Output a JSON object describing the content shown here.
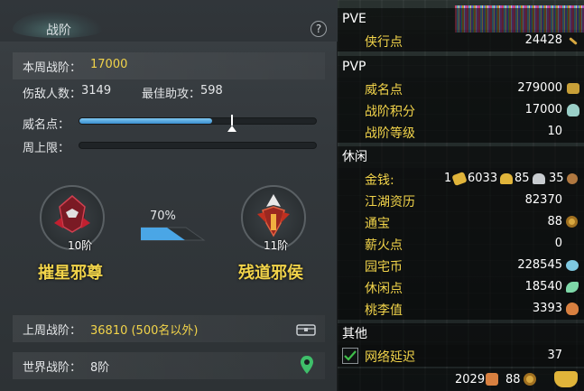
{
  "left": {
    "title": "战阶",
    "help_label": "?",
    "weekly_label": "本周战阶：",
    "weekly_value": "17000",
    "kills_label": "伤敌人数：",
    "kills_value": "3149",
    "assist_label": "最佳助攻：",
    "assist_value": "598",
    "prestige_label": "威名点：",
    "prestige_progress": 0.56,
    "weekly_cap_label": "周上限：",
    "weekly_cap_progress": 0.0,
    "current_rank": {
      "name": "摧星邪尊",
      "level": "10阶"
    },
    "next_rank": {
      "name": "残道邪侯",
      "level": "11阶"
    },
    "rank_progress_text": "70%",
    "rank_progress": 0.7,
    "last_week_label": "上周战阶：",
    "last_week_value": "36810 (500名以外)",
    "world_label": "世界战阶：",
    "world_value": "8阶"
  },
  "right": {
    "pve_title": "PVE",
    "pve_items": [
      {
        "label": "侠行点",
        "value": "24428"
      }
    ],
    "pvp_title": "PVP",
    "pvp_items": [
      {
        "label": "威名点",
        "value": "279000"
      },
      {
        "label": "战阶积分",
        "value": "17000"
      },
      {
        "label": "战阶等级",
        "value": "10"
      }
    ],
    "leisure_title": "休闲",
    "money_label": "金钱:",
    "money_gold": "1",
    "money_a": "6033",
    "money_b": "85",
    "money_c": "35",
    "leisure_items": [
      {
        "label": "江湖资历",
        "value": "82370"
      },
      {
        "label": "通宝",
        "value": "88"
      },
      {
        "label": "薪火点",
        "value": "0"
      },
      {
        "label": "园宅币",
        "value": "228545"
      },
      {
        "label": "休闲点",
        "value": "18540"
      },
      {
        "label": "桃李值",
        "value": "3393"
      }
    ],
    "other_title": "其他",
    "latency_label": "网络延迟",
    "latency_value": "37",
    "footer_a": "2029",
    "footer_b": "88"
  },
  "colors": {
    "yellow": "#f2d44a",
    "bar_blue": "#3a8fd0",
    "green_check": "#3fbf4a"
  }
}
